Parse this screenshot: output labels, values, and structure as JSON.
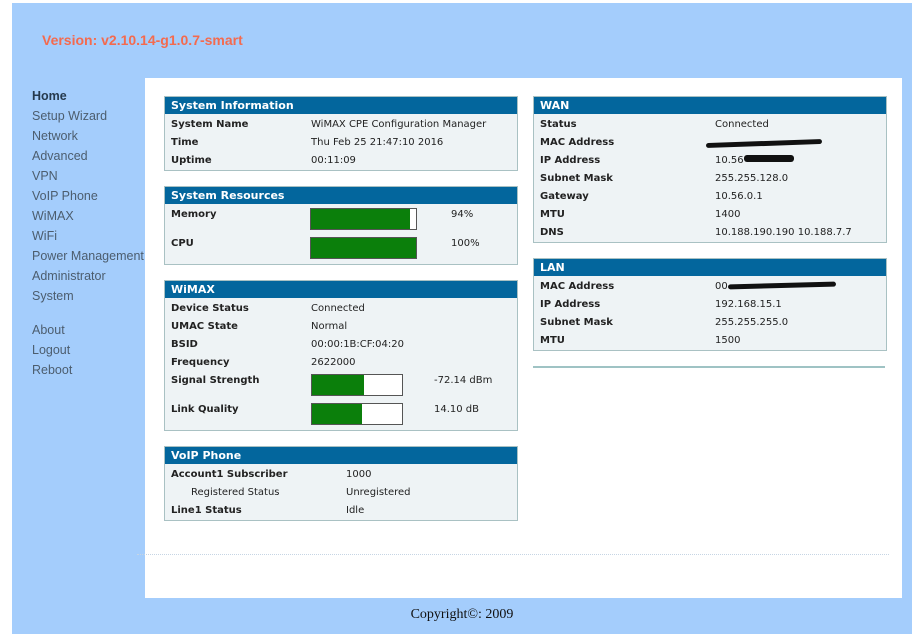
{
  "header": {
    "version": "Version: v2.10.14-g1.0.7-smart"
  },
  "nav": {
    "items": [
      "Home",
      "Setup Wizard",
      "Network",
      "Advanced",
      "VPN",
      "VoIP Phone",
      "WiMAX",
      "WiFi",
      "Power Management",
      "Administrator",
      "System"
    ],
    "secondary": [
      "About",
      "Logout",
      "Reboot"
    ],
    "active": "Home"
  },
  "system_info": {
    "title": "System Information",
    "rows": [
      {
        "label": "System Name",
        "value": "WiMAX CPE Configuration Manager"
      },
      {
        "label": "Time",
        "value": "Thu Feb 25 21:47:10 2016"
      },
      {
        "label": "Uptime",
        "value": "00:11:09"
      }
    ]
  },
  "system_resources": {
    "title": "System Resources",
    "memory": {
      "label": "Memory",
      "value": "94%",
      "fraction": 0.94
    },
    "cpu": {
      "label": "CPU",
      "value": "100%",
      "fraction": 1.0
    }
  },
  "wimax": {
    "title": "WiMAX",
    "rows": [
      {
        "label": "Device Status",
        "value": "Connected"
      },
      {
        "label": "UMAC State",
        "value": "Normal"
      },
      {
        "label": "BSID",
        "value": "00:00:1B:CF:04:20"
      },
      {
        "label": "Frequency",
        "value": "2622000"
      }
    ],
    "signal": {
      "label": "Signal Strength",
      "value": "-72.14 dBm",
      "fraction": 0.58
    },
    "link": {
      "label": "Link Quality",
      "value": "14.10 dB",
      "fraction": 0.55
    }
  },
  "voip": {
    "title": "VoIP Phone",
    "rows": [
      {
        "label": "Account1 Subscriber",
        "value": "1000"
      },
      {
        "label": "Registered Status",
        "value": "Unregistered"
      },
      {
        "label": "Line1 Status",
        "value": "Idle"
      }
    ]
  },
  "wan": {
    "title": "WAN",
    "rows": [
      {
        "label": "Status",
        "value": "Connected"
      },
      {
        "label": "MAC Address",
        "value": ""
      },
      {
        "label": "IP Address",
        "value": "10.56"
      },
      {
        "label": "Subnet Mask",
        "value": "255.255.128.0"
      },
      {
        "label": "Gateway",
        "value": "10.56.0.1"
      },
      {
        "label": "MTU",
        "value": "1400"
      },
      {
        "label": "DNS",
        "value": "10.188.190.190 10.188.7.7"
      }
    ]
  },
  "lan": {
    "title": "LAN",
    "rows": [
      {
        "label": "MAC Address",
        "value": "00"
      },
      {
        "label": "IP Address",
        "value": "192.168.15.1"
      },
      {
        "label": "Subnet Mask",
        "value": "255.255.255.0"
      },
      {
        "label": "MTU",
        "value": "1500"
      }
    ]
  },
  "footer": {
    "copyright": "Copyright©: 2009"
  },
  "colors": {
    "header_bg": "#03669d",
    "page_bg": "#a4cdfc",
    "version": "#f46a4e",
    "bar_fill": "#0b7f0b"
  }
}
